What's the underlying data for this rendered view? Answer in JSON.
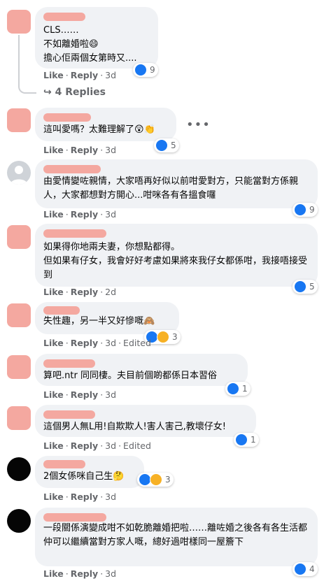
{
  "actions": {
    "like": "Like",
    "reply": "Reply",
    "sep": "·"
  },
  "thread": {
    "replies_label": "4 Replies"
  },
  "comments": [
    {
      "text": "CLS……\n不如離婚啦😄\n擔心佢兩個女第時又....",
      "time": "3d",
      "edited": "",
      "reactions": [
        "like"
      ],
      "count": "9"
    },
    {
      "text": "這叫愛嗎？太難理解了😲👏",
      "time": "3d",
      "edited": "",
      "reactions": [
        "like"
      ],
      "count": "5"
    },
    {
      "text": "由愛情變咗親情，大家唔再好似以前咁愛對方，只能當對方係親人，大家都想對方開心...咁咪各有各搵食囉",
      "time": "3d",
      "edited": "",
      "reactions": [
        "like"
      ],
      "count": "9"
    },
    {
      "text": "如果得你地兩夫妻，你想點都得。\n但如果有仔女，我會好好考慮如果將來我仔女都係咁，我接唔接受到",
      "time": "2d",
      "edited": "",
      "reactions": [
        "like"
      ],
      "count": "5"
    },
    {
      "text": "失性趣，另一半又好慘嘅🙈",
      "time": "3d",
      "edited": "Edited",
      "reactions": [
        "like",
        "sad"
      ],
      "count": "3"
    },
    {
      "text": "算吧.ntr 同同棲。夫目前個啲都係日本習俗",
      "time": "3d",
      "edited": "",
      "reactions": [
        "like"
      ],
      "count": "1"
    },
    {
      "text": "這個男人無L用!自欺欺人!害人害己,教壞仔女!",
      "time": "3d",
      "edited": "Edited",
      "reactions": [
        "like"
      ],
      "count": "1"
    },
    {
      "text": "2個女係咪自己生🤔",
      "time": "3d",
      "edited": "",
      "reactions": [
        "like",
        "haha"
      ],
      "count": "3"
    },
    {
      "text": "一段關係演變成咁不如乾脆離婚把啦……離咗婚之後各有各生活都仲可以繼續當對方家人嘅，總好過咁樣同一屋簷下",
      "time": "3d",
      "edited": "",
      "reactions": [
        "like"
      ],
      "count": "4"
    }
  ],
  "colors": {
    "bubble": "#f0f2f5",
    "meta": "#65676b",
    "like": "#1877f2",
    "redaction": "#f4a8a0"
  }
}
